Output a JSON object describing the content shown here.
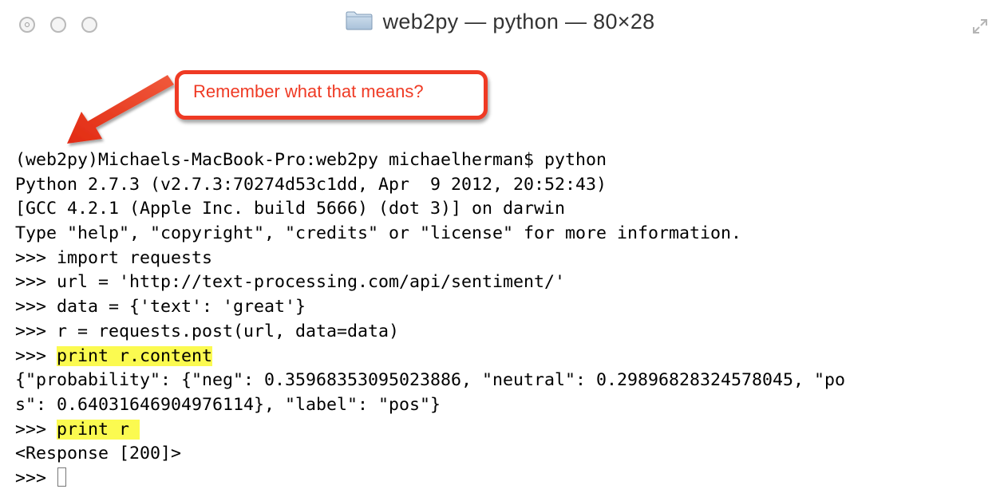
{
  "window": {
    "title": "web2py — python — 80×28",
    "folder_icon": "folder-icon",
    "resize_icon": "fullscreen-icon"
  },
  "annotation": {
    "text": "Remember what that means?",
    "color": "#ef3a24"
  },
  "highlight_color": "#fbfa50",
  "terminal": {
    "lines": [
      "(web2py)Michaels-MacBook-Pro:web2py michaelherman$ python",
      "Python 2.7.3 (v2.7.3:70274d53c1dd, Apr  9 2012, 20:52:43)",
      "[GCC 4.2.1 (Apple Inc. build 5666) (dot 3)] on darwin",
      "Type \"help\", \"copyright\", \"credits\" or \"license\" for more information.",
      ">>> import requests",
      ">>> url = 'http://text-processing.com/api/sentiment/'",
      ">>> data = {'text': 'great'}",
      ">>> r = requests.post(url, data=data)",
      {
        "prompt": ">>> ",
        "cmd": "print r.content"
      },
      "{\"probability\": {\"neg\": 0.35968353095023886, \"neutral\": 0.29896828324578045, \"po",
      "s\": 0.64031646904976114}, \"label\": \"pos\"}",
      {
        "prompt": ">>> ",
        "cmd": "print r "
      },
      "<Response [200]>",
      {
        "prompt": ">>> ",
        "cmd": ""
      }
    ]
  }
}
